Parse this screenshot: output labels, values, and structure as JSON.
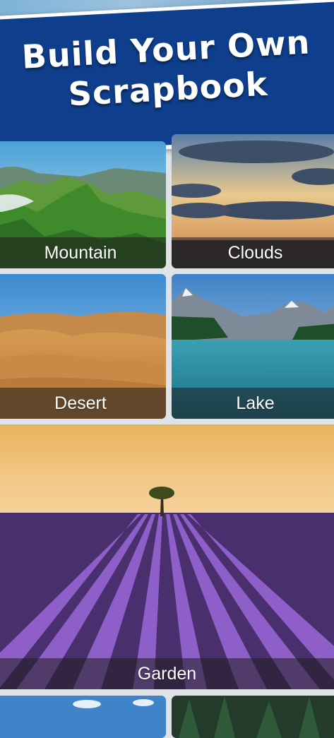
{
  "banner": {
    "title_line1": "Build Your Own",
    "title_line2": "Scrapbook"
  },
  "tiles": [
    {
      "label": "Mountain"
    },
    {
      "label": "Clouds"
    },
    {
      "label": "Desert"
    },
    {
      "label": "Lake"
    },
    {
      "label": "Garden"
    }
  ],
  "colors": {
    "banner": "#0f3e8c",
    "label_overlay": "rgba(30,30,30,0.55)",
    "background": "#dfe3e8"
  }
}
